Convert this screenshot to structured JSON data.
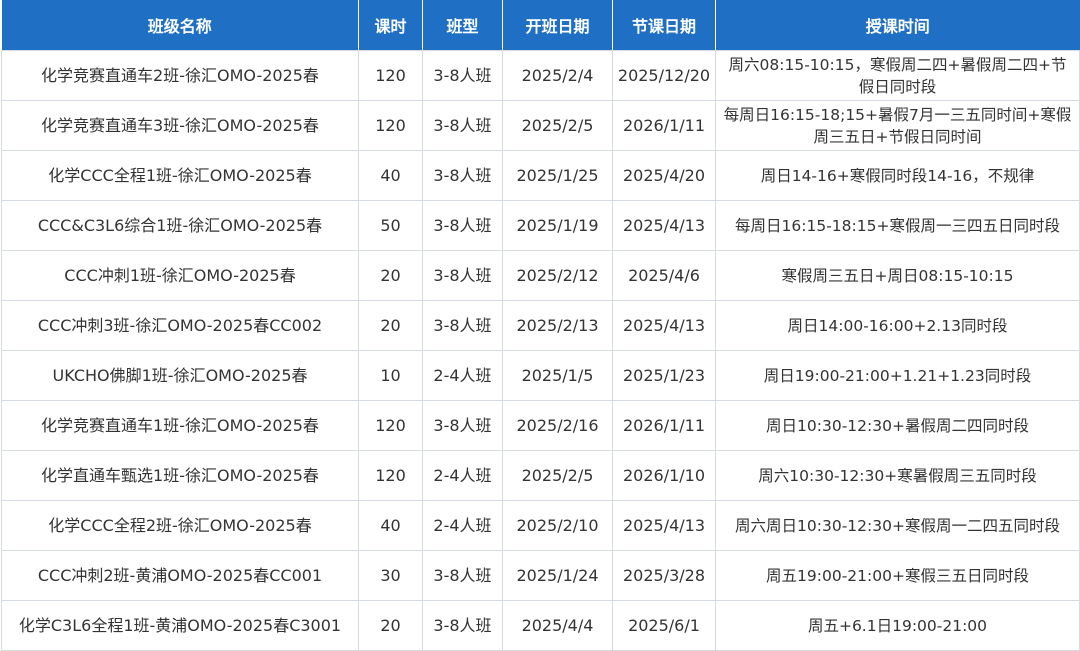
{
  "table": {
    "headers": [
      "班级名称",
      "课时",
      "班型",
      "开班日期",
      "节课日期",
      "授课时间"
    ],
    "rows": [
      [
        "化学竞赛直通车2班-徐汇OMO-2025春",
        "120",
        "3-8人班",
        "2025/2/4",
        "2025/12/20",
        "周六08:15-10:15，寒假周二四+暑假周二四+节假日同时段"
      ],
      [
        "化学竞赛直通车3班-徐汇OMO-2025春",
        "120",
        "3-8人班",
        "2025/2/5",
        "2026/1/11",
        "每周日16:15-18;15+暑假7月一三五同时间+寒假周三五日+节假日同时间"
      ],
      [
        "化学CCC全程1班-徐汇OMO-2025春",
        "40",
        "3-8人班",
        "2025/1/25",
        "2025/4/20",
        "周日14-16+寒假同时段14-16，不规律"
      ],
      [
        "CCC&C3L6综合1班-徐汇OMO-2025春",
        "50",
        "3-8人班",
        "2025/1/19",
        "2025/4/13",
        "每周日16:15-18:15+寒假周一三四五日同时段"
      ],
      [
        "CCC冲刺1班-徐汇OMO-2025春",
        "20",
        "3-8人班",
        "2025/2/12",
        "2025/4/6",
        "寒假周三五日+周日08:15-10:15"
      ],
      [
        "CCC冲刺3班-徐汇OMO-2025春CC002",
        "20",
        "3-8人班",
        "2025/2/13",
        "2025/4/13",
        "周日14:00-16:00+2.13同时段"
      ],
      [
        "UKCHO佛脚1班-徐汇OMO-2025春",
        "10",
        "2-4人班",
        "2025/1/5",
        "2025/1/23",
        "周日19:00-21:00+1.21+1.23同时段"
      ],
      [
        "化学竞赛直通车1班-徐汇OMO-2025春",
        "120",
        "3-8人班",
        "2025/2/16",
        "2026/1/11",
        "周日10:30-12:30+暑假周二四同时段"
      ],
      [
        "化学直通车甄选1班-徐汇OMO-2025春",
        "120",
        "2-4人班",
        "2025/2/5",
        "2026/1/10",
        "周六10:30-12:30+寒暑假周三五同时段"
      ],
      [
        "化学CCC全程2班-徐汇OMO-2025春",
        "40",
        "2-4人班",
        "2025/2/10",
        "2025/4/13",
        "周六周日10:30-12:30+寒假周一二四五同时段"
      ],
      [
        "CCC冲刺2班-黄浦OMO-2025春CC001",
        "30",
        "3-8人班",
        "2025/1/24",
        "2025/3/28",
        "周五19:00-21:00+寒假三五日同时段"
      ],
      [
        "化学C3L6全程1班-黄浦OMO-2025春C3001",
        "20",
        "3-8人班",
        "2025/4/4",
        "2025/6/1",
        "周五+6.1日19:00-21:00"
      ]
    ]
  },
  "colors": {
    "header_bg": "#1f6fc5",
    "header_text": "#ffffff",
    "border": "#d6dbe3",
    "cell_text": "#333333"
  }
}
